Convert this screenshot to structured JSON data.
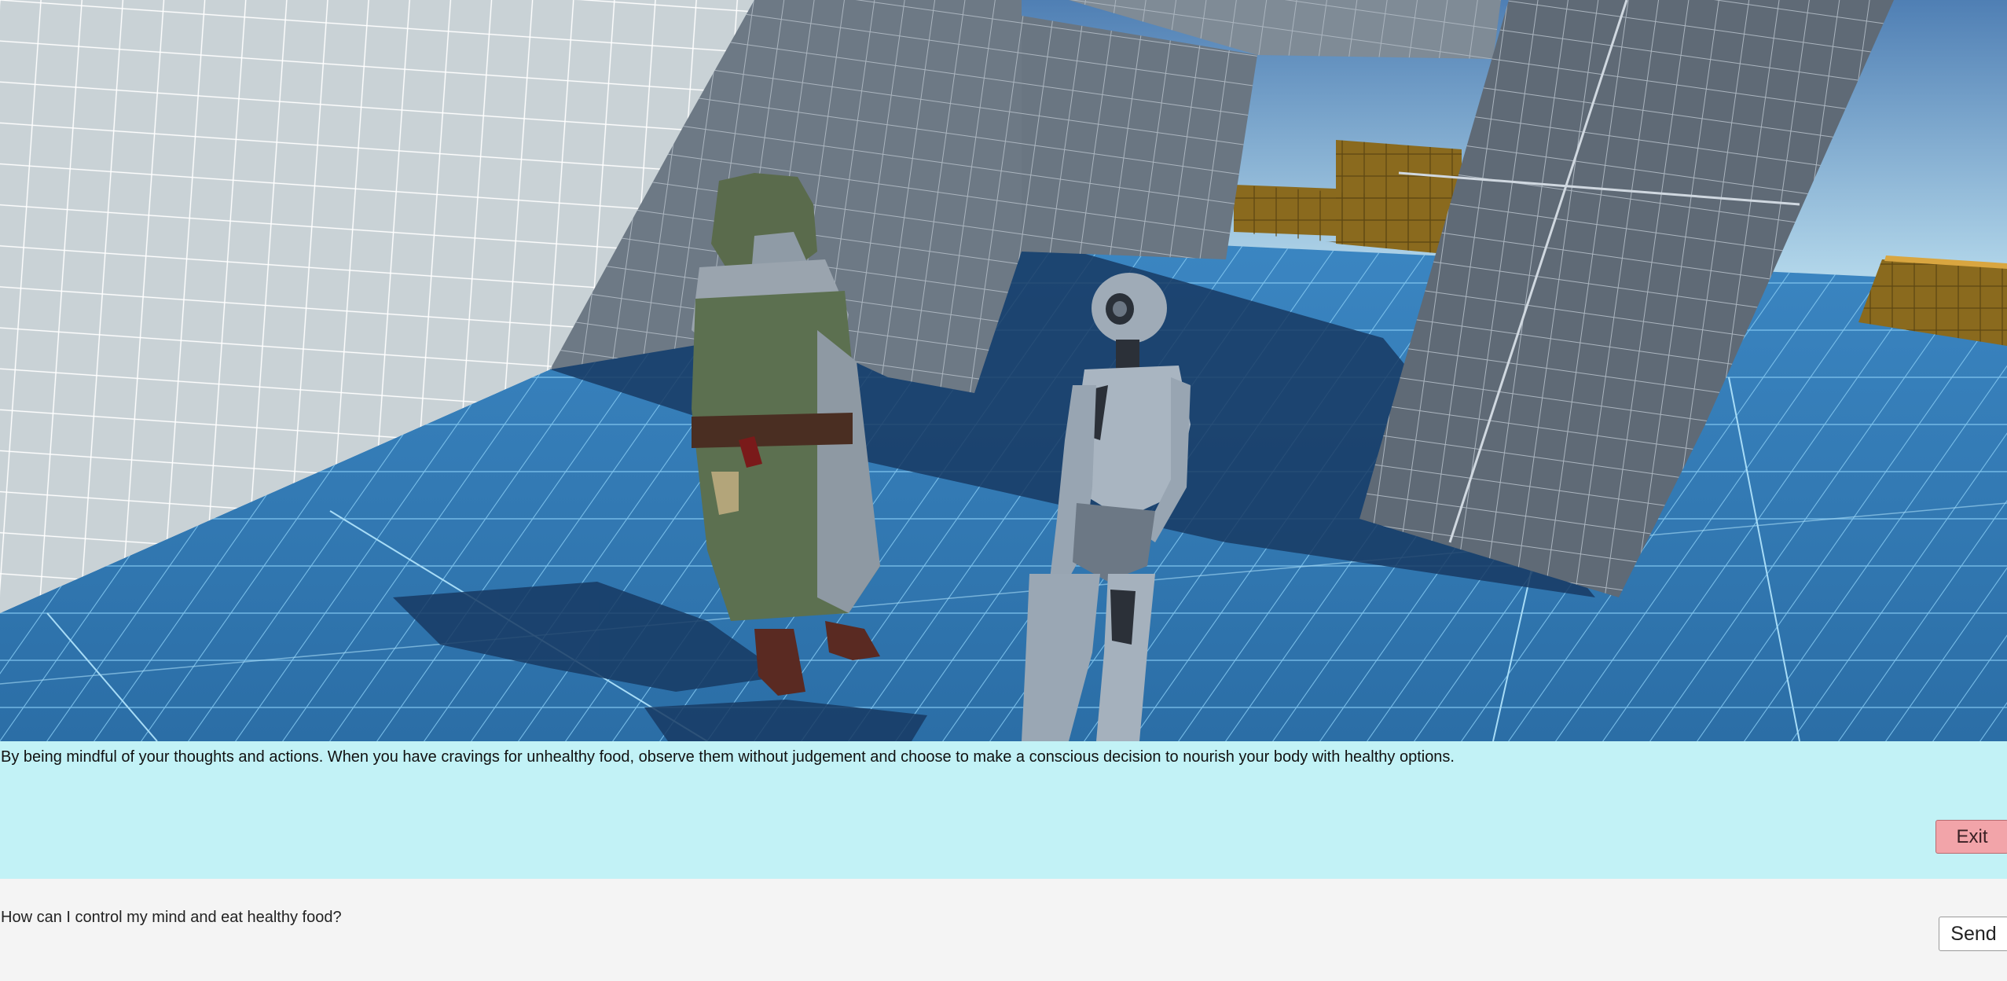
{
  "scene": {
    "description_name": "3d-game-viewport",
    "colors": {
      "sky_top": "#4f7fb4",
      "sky_bottom": "#bfe3f4",
      "floor": "#2f74ad",
      "wall_light": "#c9d2d6",
      "wall_dark": "#5f6a76",
      "platform": "#8a6a1e",
      "cloak": "#5c7050",
      "robot": "#9aa7b4"
    }
  },
  "response": {
    "text": "By being mindful of your thoughts and actions. When you have cravings for unhealthy food, observe them without judgement and choose to make a conscious decision to nourish your body with healthy options.",
    "exit_label": "Exit"
  },
  "input": {
    "query": "How can I control my mind and eat healthy food?",
    "send_label": "Send"
  }
}
